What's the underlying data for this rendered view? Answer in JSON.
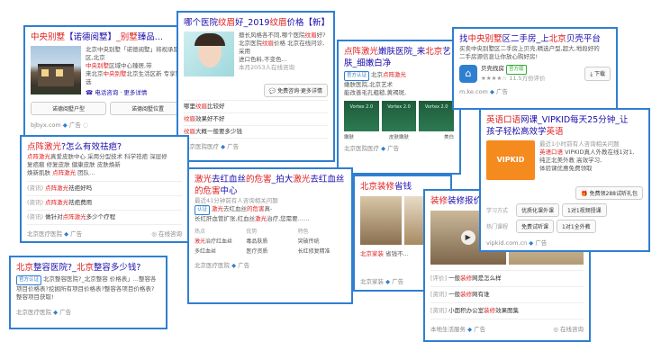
{
  "c1": {
    "title_a": "中央别墅",
    "title_b": "【诺德阅墅】",
    "title_c": "_别墅",
    "title_d": "臻品...",
    "d1": "北京中央别墅「诺德阅墅」将视承别墅区,北京",
    "d1r": "中央别墅",
    "d1b": "区域中心臻居,带",
    "d2": "来北京",
    "d2r": "中央别墅",
    "d2b": "北京生活区新 专享臻选",
    "phone": "电话咨询 · 更多详情",
    "btn1": "诺德阅墅户型",
    "btn2": "诺德阅墅位置",
    "source": "bjbyx.com",
    "ad": "广告"
  },
  "c2": {
    "title_a": "哪个医院",
    "title_b": "纹眉",
    "title_c": "好_2019",
    "title_d": "纹眉",
    "title_e": "价格【新】",
    "d1": "擅长风格各不同,哪个医院",
    "d1r": "纹眉",
    "d1b": "好?",
    "d2": "北京医院",
    "d2r": "纹眉",
    "d2b": "价格 北京在线问诊,采用",
    "d3": "进口色料,不变色...",
    "d4": "本月2053人在线咨询",
    "btn": "免费咨询·更多详情",
    "r1a": "哪里",
    "r1r": "纹眉",
    "r1b": "比较好",
    "r2a": "纹眉",
    "r2r": "效果好不好",
    "r3r": "纹眉",
    "r3b": "大概一般要多少钱",
    "source": "北京医院医疗",
    "ad": "广告"
  },
  "c3": {
    "title_a": "点阵激光",
    "title_b": "嫩肤医院_来",
    "title_c": "北京",
    "title_d": "艺",
    "title2": "肤_细嫩白净",
    "tag": "官方认证",
    "d1": "北京",
    "d1r": "点阵激光",
    "d1b": "嫩肤医院,北京艺术",
    "d2": "能改善",
    "d2b": "毛孔粗糙,黄褐斑,",
    "lbl1": "嫩肤",
    "lbl2": "皮肤嫩肤",
    "lbl3": "美白",
    "source": "北京医院医疗",
    "ad": "广告",
    "img": "Vortex 2.0"
  },
  "c4": {
    "title_a": "点阵激光",
    "title_b": "?怎么有效祛疤?",
    "d1": "点阵激光",
    "d1b": "真爱皮肤中心 采用分型技术 科学祛疤 深层修",
    "d2": "复",
    "d2b": "疤痕 修复皮肤 健康皮肤 皮肤焕新",
    "d3a": "焕新肌肤 ",
    "d3r": "点阵激光",
    "d3b": " 团队...",
    "r1a": "(资讯)",
    "r1r": "点阵激光",
    "r1b": "祛疤好吗",
    "r2a": "(资讯)",
    "r2r": "点阵激光",
    "r2b": "祛疤费用",
    "r3a": "(资讯)",
    "r3b": "做针对",
    "r3r": "点阵激光",
    "r3c": "多少个疗程",
    "source": "北京医疗医院",
    "ad": "广告",
    "online": "在线咨询"
  },
  "c5": {
    "title_a": "北京",
    "title_b": "整容医院?_",
    "title_c": "北京",
    "title_d": "整容多少钱?",
    "tag": "官方认证",
    "d1": "北京整容医院?_北京整容 价格表」...整容各",
    "d2": "项目价格表?挖掘所有项目价格表?整容各项目价格表?",
    "d3": "整容项目获取!",
    "source": "北京医疗医院",
    "ad": "广告"
  },
  "c6": {
    "title_a": "激光",
    "title_b": "去红血丝",
    "title_c": "的危害",
    "title_d": "_拍大",
    "title_e": "激光",
    "title_f": "去红血丝",
    "title2_a": "的危害",
    "title2_b": "中心",
    "d0": "最近41分钟前有人咨询相关问题",
    "d1a": "激光",
    "d1b": "去红血丝",
    "d1c": "的危害",
    "d1d": "真-",
    "d2": "长红肝血管扩张,红血丝",
    "d2r": "激光",
    "d2b": "治疗,您需要……",
    "h1": "热点",
    "h2": "优势",
    "h3": "特色",
    "g1": "激光",
    "g1b": "治疗红血丝",
    "g2": "毒品肤质",
    "g3": "突破传统",
    "g4": "多红血丝",
    "g5": "医疗资质",
    "g6": "长红修复精准",
    "source": "北京医疗医院",
    "ad": "广告"
  },
  "c7": {
    "title_a": "北京",
    "title_b": "装修",
    "title_c": "省钱",
    "d1": "北京家装",
    "d1b": "省钱",
    "d1c": "不...",
    "source": "北京家装",
    "ad": "广告"
  },
  "c8": {
    "title_a": "装修",
    "title_b": "装修报价",
    "r1a": "[评价]",
    "r1b": "一般",
    "r1r": "装修",
    "r1c": "网是怎么样",
    "r2a": "[资讯]",
    "r2b": "一般",
    "r2r": "装修",
    "r2c": "网有谁",
    "r3a": "[资讯]",
    "r3b": "小面积办公室",
    "r3r": "装修",
    "r3c": "效果图集",
    "source": "本地生活服务",
    "ad": "广告",
    "online": "在线咨询"
  },
  "c9": {
    "title_a": "找",
    "title_b": "中央别墅",
    "title_c": "区二手房_上",
    "title_d": "北京",
    "title_e": "贝壳平台",
    "d1": "买卖中央别墅区二手房上贝壳,精选户型,超大,地段好的",
    "d2": "二手房源信息让你放心购好房!",
    "app": "贝壳找房",
    "official": "官方版",
    "rating": "★★★★☆ 11.5万份评价",
    "btn": "下载",
    "source": "m.ke.com",
    "ad": "广告"
  },
  "c10": {
    "title_a": "英语口语",
    "title_b": "网课_VIPKID每天25分钟_让",
    "title2_a": "孩子轻松高效学",
    "title2_b": "英语",
    "d0": "最近1小时前有人咨询相关问题",
    "d1a": "英语口语",
    "d1b": " VIPKID真人外教在线1对1,",
    "d2": "纯正北美外教 高效学习,",
    "d3": "体验课优惠免费领取",
    "logo": "VIPKID",
    "free": "免费领288试听礼包",
    "rl1": "学习方式",
    "b1": "优质化课外课",
    "b2": "1对1视频授课",
    "rl2": "热门课程",
    "b3": "免费试听课",
    "b4": "1对1全外教",
    "source": "vipkid.com.cn",
    "ad": "广告"
  }
}
